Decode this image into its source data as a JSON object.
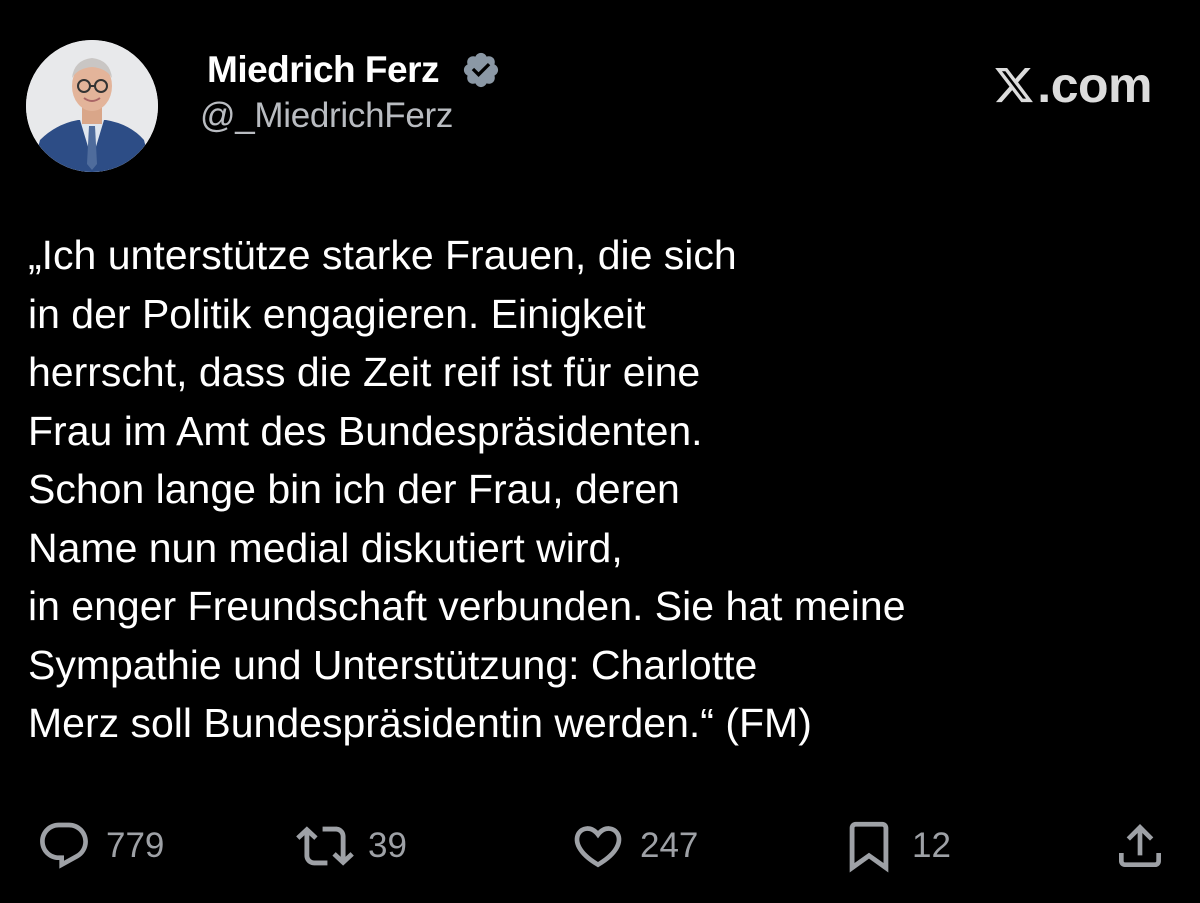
{
  "header": {
    "display_name": "Miedrich Ferz",
    "handle": "@_MiedrichFerz",
    "verified": true,
    "brand": ".com",
    "brand_icon": "x-logo-icon"
  },
  "tweet": {
    "lines": [
      "„Ich unterstütze starke Frauen, die sich",
      "in der Politik engagieren. Einigkeit",
      "herrscht, dass die Zeit reif ist für eine",
      "Frau im Amt des Bundespräsidenten.",
      "Schon lange bin ich der Frau, deren",
      "Name nun medial diskutiert wird,",
      "in enger Freundschaft verbunden. Sie hat meine",
      "Sympathie und Unterstützung: Charlotte",
      "Merz soll Bundespräsidentin werden.“ (FM)"
    ]
  },
  "actions": {
    "reply": {
      "icon": "reply-icon",
      "count": "779"
    },
    "repost": {
      "icon": "repost-icon",
      "count": "39"
    },
    "like": {
      "icon": "heart-icon",
      "count": "247"
    },
    "bookmark": {
      "icon": "bookmark-icon",
      "count": "12"
    },
    "share": {
      "icon": "share-icon"
    }
  },
  "colors": {
    "background": "#000000",
    "text": "#ffffff",
    "muted": "#9ea1a6",
    "verified": "#8b98a5"
  }
}
